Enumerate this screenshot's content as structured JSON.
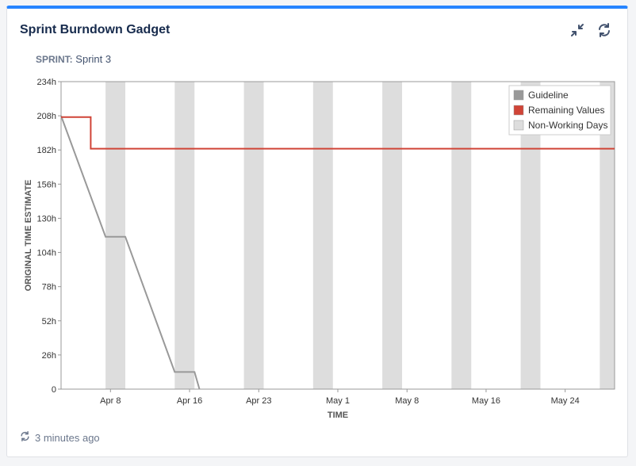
{
  "gadget": {
    "title": "Sprint Burndown Gadget",
    "sprint_label": "SPRINT:",
    "sprint_value": "Sprint 3",
    "footer_text": "3 minutes ago",
    "icons": [
      "collapse-icon",
      "refresh-icon"
    ]
  },
  "colors": {
    "accent": "#2684ff",
    "guideline": "#999999",
    "remaining": "#d04437",
    "non_working": "#dddddd"
  },
  "chart_data": {
    "type": "line",
    "title": "",
    "xlabel": "TIME",
    "ylabel": "ORIGINAL TIME ESTIMATE",
    "x_range": [
      "Apr 3",
      "May 29"
    ],
    "ylim": [
      0,
      234
    ],
    "y_ticks": [
      "0",
      "26h",
      "52h",
      "78h",
      "104h",
      "130h",
      "156h",
      "182h",
      "208h",
      "234h"
    ],
    "x_ticks": [
      {
        "label": "Apr 8",
        "date": "Apr 8"
      },
      {
        "label": "Apr 16",
        "date": "Apr 16"
      },
      {
        "label": "Apr 23",
        "date": "Apr 23"
      },
      {
        "label": "May 1",
        "date": "May 1"
      },
      {
        "label": "May 8",
        "date": "May 8"
      },
      {
        "label": "May 16",
        "date": "May 16"
      },
      {
        "label": "May 24",
        "date": "May 24"
      }
    ],
    "legend_position": "top-right",
    "legend": [
      "Guideline",
      "Remaining Values",
      "Non-Working Days"
    ],
    "series": [
      {
        "name": "Guideline",
        "points": [
          {
            "x": "Apr 3",
            "y": 208
          },
          {
            "x": "Apr 7.5",
            "y": 116
          },
          {
            "x": "Apr 9.5",
            "y": 116
          },
          {
            "x": "Apr 14.5",
            "y": 13
          },
          {
            "x": "Apr 16.5",
            "y": 13
          },
          {
            "x": "Apr 17",
            "y": 0
          }
        ]
      },
      {
        "name": "Remaining Values",
        "points": [
          {
            "x": "Apr 3",
            "y": 207
          },
          {
            "x": "Apr 6",
            "y": 207
          },
          {
            "x": "Apr 6",
            "y": 183
          },
          {
            "x": "May 29",
            "y": 183
          }
        ]
      }
    ],
    "non_working_days": [
      {
        "start": "Apr 7.5",
        "end": "Apr 9.5"
      },
      {
        "start": "Apr 14.5",
        "end": "Apr 16.5"
      },
      {
        "start": "Apr 21.5",
        "end": "Apr 23.5"
      },
      {
        "start": "Apr 28.5",
        "end": "Apr 30.5"
      },
      {
        "start": "May 5.5",
        "end": "May 7.5"
      },
      {
        "start": "May 12.5",
        "end": "May 14.5"
      },
      {
        "start": "May 19.5",
        "end": "May 21.5"
      },
      {
        "start": "May 27.5",
        "end": "May 29"
      }
    ],
    "grid": false
  }
}
